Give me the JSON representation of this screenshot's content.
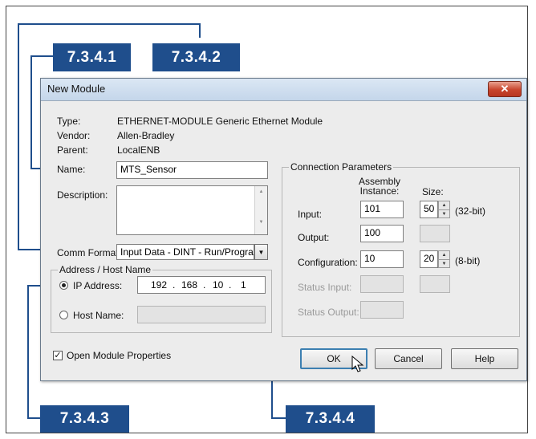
{
  "callouts": {
    "c1": "7.3.4.1",
    "c2": "7.3.4.2",
    "c3": "7.3.4.3",
    "c4": "7.3.4.4",
    "color": "#1f4e8c"
  },
  "dialog": {
    "title": "New Module",
    "close_glyph": "✕",
    "type_label": "Type:",
    "type_value": "ETHERNET-MODULE Generic Ethernet Module",
    "vendor_label": "Vendor:",
    "vendor_value": "Allen-Bradley",
    "parent_label": "Parent:",
    "parent_value": "LocalENB",
    "name_label": "Name:",
    "name_value": "MTS_Sensor",
    "description_label": "Description:",
    "description_value": "",
    "comm_format_label": "Comm Format:",
    "comm_format_value": "Input Data - DINT - Run/Program",
    "address_group_title": "Address / Host Name",
    "ip_label": "IP Address:",
    "ip_octets": [
      "192",
      "168",
      "10",
      "1"
    ],
    "ip_selected": true,
    "host_label": "Host Name:",
    "host_value": "",
    "open_props_label": "Open Module Properties",
    "open_props_checked": true
  },
  "connection": {
    "title": "Connection Parameters",
    "col_assembly": "Assembly\nInstance:",
    "col_size": "Size:",
    "rows": [
      {
        "label": "Input:",
        "instance": "101",
        "size": "50",
        "unit": "(32-bit)",
        "enabled": true
      },
      {
        "label": "Output:",
        "instance": "100",
        "size": "",
        "unit": "",
        "enabled": true
      },
      {
        "label": "Configuration:",
        "instance": "10",
        "size": "20",
        "unit": "(8-bit)",
        "enabled": true
      },
      {
        "label": "Status Input:",
        "instance": "",
        "size": "",
        "unit": "",
        "enabled": false
      },
      {
        "label": "Status Output:",
        "instance": "",
        "size": "",
        "unit": "",
        "enabled": false
      }
    ]
  },
  "buttons": {
    "ok": "OK",
    "cancel": "Cancel",
    "help": "Help"
  }
}
